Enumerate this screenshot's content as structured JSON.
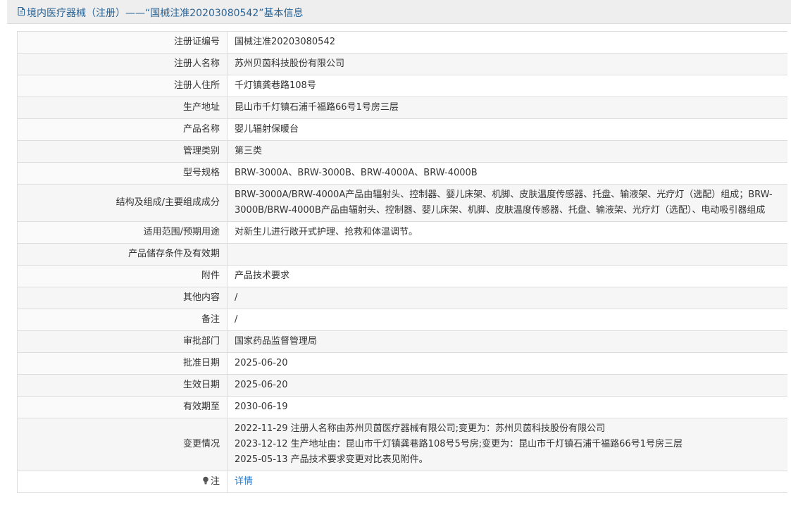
{
  "header": {
    "title": "境内医疗器械（注册）——“国械注准20203080542”基本信息"
  },
  "rows": [
    {
      "label": "注册证编号",
      "value": "国械注准20203080542"
    },
    {
      "label": "注册人名称",
      "value": "苏州贝茵科技股份有限公司"
    },
    {
      "label": "注册人住所",
      "value": "千灯镇龚巷路108号"
    },
    {
      "label": "生产地址",
      "value": "昆山市千灯镇石浦千福路66号1号房三层"
    },
    {
      "label": "产品名称",
      "value": "婴儿辐射保暖台"
    },
    {
      "label": "管理类别",
      "value": "第三类"
    },
    {
      "label": "型号规格",
      "value": "BRW-3000A、BRW-3000B、BRW-4000A、BRW-4000B"
    },
    {
      "label": "结构及组成/主要组成成分",
      "value": "BRW-3000A/BRW-4000A产品由辐射头、控制器、婴儿床架、机脚、皮肤温度传感器、托盘、输液架、光疗灯（选配）组成；BRW-3000B/BRW-4000B产品由辐射头、控制器、婴儿床架、机脚、皮肤温度传感器、托盘、输液架、光疗灯（选配）、电动吸引器组成"
    },
    {
      "label": "适用范围/预期用途",
      "value": "对新生儿进行敞开式护理、抢救和体温调节。"
    },
    {
      "label": "产品储存条件及有效期",
      "value": ""
    },
    {
      "label": "附件",
      "value": "产品技术要求"
    },
    {
      "label": "其他内容",
      "value": "/"
    },
    {
      "label": "备注",
      "value": "/"
    },
    {
      "label": "审批部门",
      "value": "国家药品监督管理局"
    },
    {
      "label": "批准日期",
      "value": "2025-06-20"
    },
    {
      "label": "生效日期",
      "value": "2025-06-20"
    },
    {
      "label": "有效期至",
      "value": "2030-06-19"
    }
  ],
  "changes": {
    "label": "变更情况",
    "lines": [
      "2022-11-29 注册人名称由苏州贝茵医疗器械有限公司;变更为：苏州贝茵科技股份有限公司",
      "2023-12-12 生产地址由：昆山市千灯镇龚巷路108号5号房;变更为：昆山市千灯镇石浦千福路66号1号房三层",
      "2025-05-13 产品技术要求变更对比表见附件。"
    ]
  },
  "note": {
    "label": "注",
    "link": "详情"
  },
  "colors": {
    "link": "#1f7ad1",
    "header_text": "#2a6496",
    "border": "#dddddd"
  }
}
